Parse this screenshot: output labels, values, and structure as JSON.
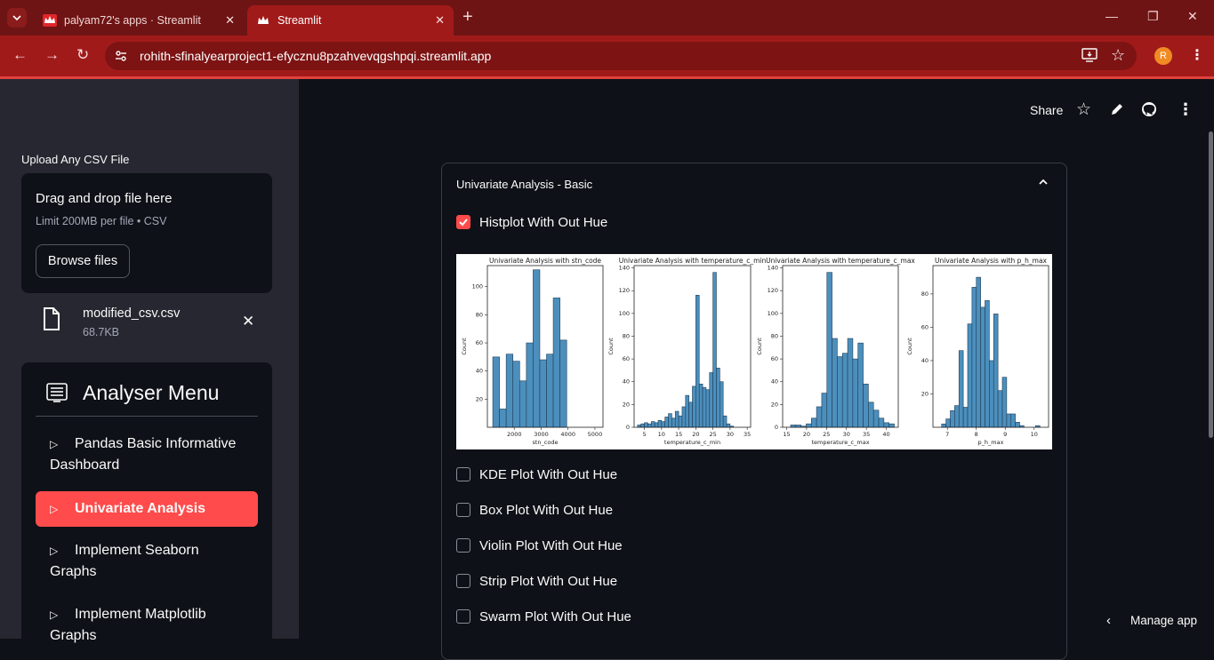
{
  "browser": {
    "tabs": [
      {
        "title": "palyam72's apps · Streamlit"
      },
      {
        "title": "Streamlit"
      }
    ],
    "url": "rohith-sfinalyearproject1-efycznu8pzahvevqgshpqi.streamlit.app",
    "profile_initial": "R"
  },
  "header": {
    "share": "Share"
  },
  "sidebar": {
    "upload_label": "Upload Any CSV File",
    "dropzone_title": "Drag and drop file here",
    "dropzone_limit": "Limit 200MB per file • CSV",
    "browse_label": "Browse files",
    "file_name": "modified_csv.csv",
    "file_size": "68.7KB",
    "menu_title": "Analyser Menu",
    "menu_items": [
      {
        "line1": "Pandas Basic Informative",
        "line2": "Dashboard"
      },
      {
        "line1": "Univariate Analysis",
        "line2": ""
      },
      {
        "line1": "Implement Seaborn",
        "line2": "Graphs"
      },
      {
        "line1": "Implement Matplotlib",
        "line2": "Graphs"
      }
    ]
  },
  "main": {
    "expander_title": "Univariate Analysis - Basic",
    "checkboxes": [
      {
        "label": "Histplot With Out Hue",
        "checked": true
      },
      {
        "label": "KDE Plot With Out Hue",
        "checked": false
      },
      {
        "label": "Box Plot With Out Hue",
        "checked": false
      },
      {
        "label": "Violin Plot With Out Hue",
        "checked": false
      },
      {
        "label": "Strip Plot With Out Hue",
        "checked": false
      },
      {
        "label": "Swarm Plot With Out Hue",
        "checked": false
      }
    ]
  },
  "footer": {
    "manage_app": "Manage app"
  },
  "colors": {
    "accent": "#ff4b4b",
    "bar": "#4c8fbd",
    "browser": "#a11a1a"
  },
  "chart_data": [
    {
      "type": "bar",
      "title": "Univariate Analysis with stn_code",
      "xlabel": "stn_code",
      "ylabel": "Count",
      "xticks": [
        "2000",
        "3000",
        "4000",
        "5000"
      ],
      "xrange": [
        1000,
        5300
      ],
      "yticks": [
        20,
        40,
        60,
        80,
        100
      ],
      "ylim": [
        0,
        115
      ],
      "bins": [
        [
          1200,
          1450,
          50
        ],
        [
          1450,
          1700,
          13
        ],
        [
          1700,
          1950,
          52
        ],
        [
          1950,
          2200,
          47
        ],
        [
          2200,
          2450,
          33
        ],
        [
          2450,
          2700,
          60
        ],
        [
          2700,
          2950,
          112
        ],
        [
          2950,
          3200,
          48
        ],
        [
          3200,
          3450,
          52
        ],
        [
          3450,
          3700,
          92
        ],
        [
          3700,
          3950,
          62
        ]
      ]
    },
    {
      "type": "bar",
      "title": "Univariate Analysis with temperature_c_min",
      "xlabel": "temperature_c_min",
      "ylabel": "Count",
      "xticks": [
        "5",
        "10",
        "15",
        "20",
        "25",
        "30",
        "35"
      ],
      "xrange": [
        2,
        36
      ],
      "yticks": [
        0,
        20,
        40,
        60,
        80,
        100,
        120,
        140
      ],
      "ylim": [
        0,
        142
      ],
      "bins": [
        [
          3,
          4,
          2
        ],
        [
          4,
          5,
          3
        ],
        [
          5,
          6,
          4
        ],
        [
          6,
          7,
          3
        ],
        [
          7,
          8,
          5
        ],
        [
          8,
          9,
          4
        ],
        [
          9,
          10,
          6
        ],
        [
          10,
          11,
          5
        ],
        [
          11,
          12,
          9
        ],
        [
          12,
          13,
          12
        ],
        [
          13,
          14,
          8
        ],
        [
          14,
          15,
          14
        ],
        [
          15,
          16,
          10
        ],
        [
          16,
          17,
          18
        ],
        [
          17,
          18,
          28
        ],
        [
          18,
          19,
          22
        ],
        [
          19,
          20,
          36
        ],
        [
          20,
          21,
          116
        ],
        [
          21,
          22,
          38
        ],
        [
          22,
          23,
          35
        ],
        [
          23,
          24,
          33
        ],
        [
          24,
          25,
          48
        ],
        [
          25,
          26,
          136
        ],
        [
          26,
          27,
          52
        ],
        [
          27,
          28,
          40
        ],
        [
          28,
          29,
          10
        ],
        [
          29,
          30,
          3
        ],
        [
          30,
          31,
          1
        ]
      ]
    },
    {
      "type": "bar",
      "title": "Univariate Analysis with temperature_c_max",
      "xlabel": "temperature_c_max",
      "ylabel": "Count",
      "xticks": [
        "15",
        "20",
        "25",
        "30",
        "35",
        "40"
      ],
      "xrange": [
        14,
        43
      ],
      "yticks": [
        0,
        20,
        40,
        60,
        80,
        100,
        120,
        140
      ],
      "ylim": [
        0,
        142
      ],
      "bins": [
        [
          16,
          17.3,
          2
        ],
        [
          17.3,
          18.6,
          2
        ],
        [
          18.6,
          19.9,
          1
        ],
        [
          19.9,
          21.2,
          3
        ],
        [
          21.2,
          22.5,
          8
        ],
        [
          22.5,
          23.8,
          18
        ],
        [
          23.8,
          25.1,
          30
        ],
        [
          25.1,
          26.4,
          136
        ],
        [
          26.4,
          27.7,
          78
        ],
        [
          27.7,
          29,
          62
        ],
        [
          29,
          30.3,
          65
        ],
        [
          30.3,
          31.6,
          78
        ],
        [
          31.6,
          32.9,
          60
        ],
        [
          32.9,
          34.2,
          74
        ],
        [
          34.2,
          35.5,
          38
        ],
        [
          35.5,
          36.8,
          22
        ],
        [
          36.8,
          38.1,
          15
        ],
        [
          38.1,
          39.4,
          8
        ],
        [
          39.4,
          40.7,
          4
        ],
        [
          40.7,
          42,
          3
        ]
      ]
    },
    {
      "type": "bar",
      "title": "Univariate Analysis with p_h_max",
      "xlabel": "p_h_max",
      "ylabel": "Count",
      "xticks": [
        "7",
        "8",
        "9",
        "10"
      ],
      "xrange": [
        6.5,
        10.5
      ],
      "yticks": [
        20,
        40,
        60,
        80
      ],
      "ylim": [
        0,
        97
      ],
      "bins": [
        [
          6.8,
          6.95,
          2
        ],
        [
          6.95,
          7.1,
          5
        ],
        [
          7.1,
          7.25,
          10
        ],
        [
          7.25,
          7.4,
          13
        ],
        [
          7.4,
          7.55,
          46
        ],
        [
          7.55,
          7.7,
          12
        ],
        [
          7.7,
          7.85,
          62
        ],
        [
          7.85,
          8,
          84
        ],
        [
          8,
          8.15,
          90
        ],
        [
          8.15,
          8.3,
          72
        ],
        [
          8.3,
          8.45,
          76
        ],
        [
          8.45,
          8.6,
          40
        ],
        [
          8.6,
          8.75,
          68
        ],
        [
          8.75,
          8.9,
          22
        ],
        [
          8.9,
          9.05,
          30
        ],
        [
          9.05,
          9.2,
          8
        ],
        [
          9.2,
          9.35,
          8
        ],
        [
          9.35,
          9.5,
          3
        ],
        [
          9.5,
          9.65,
          1
        ],
        [
          10.05,
          10.2,
          1
        ]
      ]
    }
  ]
}
